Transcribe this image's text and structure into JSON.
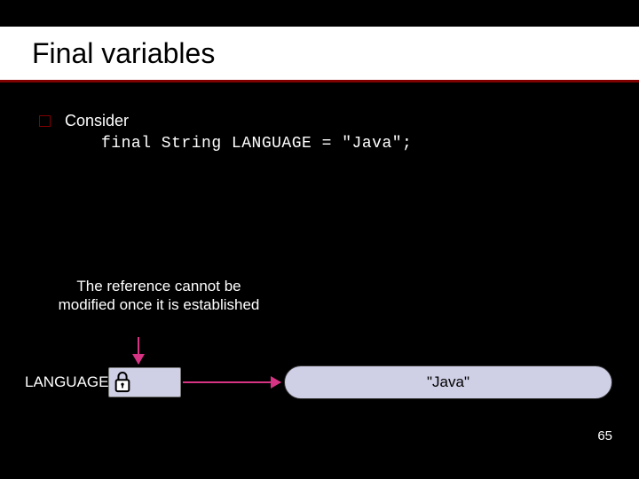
{
  "title": "Final variables",
  "bullet": {
    "text": "Consider"
  },
  "code": "final String LANGUAGE = \"Java\";",
  "note": "The reference cannot be modified once it is established",
  "diagram": {
    "var_label": "LANGUAGE",
    "lock_icon": "lock-icon",
    "value": "\"Java\""
  },
  "page_number": "65",
  "colors": {
    "accent": "#800000",
    "arrow": "#d63384",
    "box": "#cfcfe6"
  }
}
